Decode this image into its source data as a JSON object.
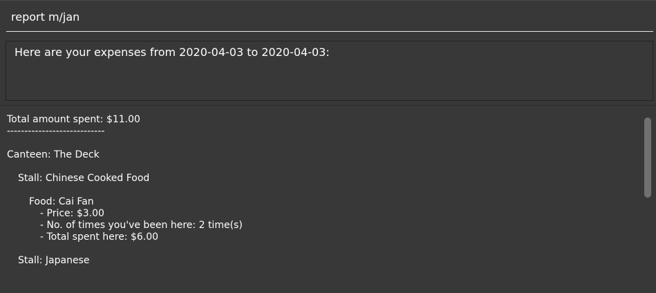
{
  "command": {
    "value": "report m/jan"
  },
  "result": {
    "message": "Here are your expenses from 2020-04-03 to 2020-04-03:"
  },
  "report": {
    "total_line": "Total amount spent: $11.00",
    "divider": "----------------------------",
    "canteen": "Canteen: The Deck",
    "stall_1": "Stall: Chinese Cooked Food",
    "food_1": "Food: Cai Fan",
    "price_1": "- Price: $3.00",
    "visits_1": "- No. of times you've been here: 2 time(s)",
    "spent_1": "- Total spent here: $6.00",
    "stall_2": "Stall: Japanese"
  },
  "scrollbar": {
    "position": 0
  }
}
